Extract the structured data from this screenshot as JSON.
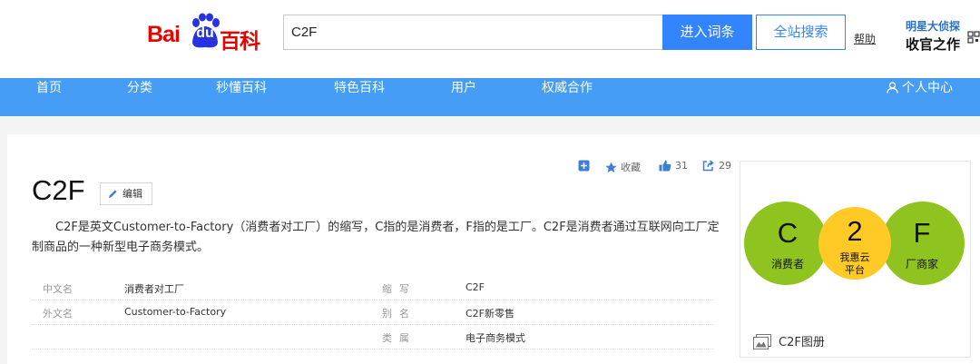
{
  "header": {
    "logo": {
      "bai": "Bai",
      "du": "du",
      "baike": "百科",
      "brand_color": "#e10602"
    },
    "search": {
      "value": "C2F"
    },
    "enter_button": "进入词条",
    "site_search_button": "全站搜索",
    "help": "帮助",
    "promo": {
      "line1": "明星大侦探",
      "line2": "收官之作"
    }
  },
  "nav": {
    "items": [
      "首页",
      "分类",
      "秒懂百科",
      "特色百科",
      "用户",
      "权威合作"
    ],
    "user_center": "个人中心",
    "bg_color": "#459df5"
  },
  "actions": {
    "collect": "收藏",
    "likes": "31",
    "shares": "29"
  },
  "article": {
    "title": "C2F",
    "edit": "编辑",
    "summary": "C2F是英文Customer-to-Factory（消费者对工厂）的缩写，C指的是消费者，F指的是工厂。C2F是消费者通过互联网向工厂定制商品的一种新型电子商务模式。",
    "basic_info": [
      {
        "k1": "中文名",
        "v1": "消费者对工厂",
        "k2": "缩写",
        "v2": "C2F"
      },
      {
        "k1": "外文名",
        "v1": "Customer-to-Factory",
        "k2": "别名",
        "v2": "C2F新零售"
      },
      {
        "k1": "",
        "v1": "",
        "k2": "类属",
        "v2": "电子商务模式"
      }
    ]
  },
  "album": {
    "label": "C2F图册",
    "diagram": {
      "left": {
        "big": "C",
        "small": "消费者"
      },
      "middle": {
        "big": "2",
        "small1": "我惠云",
        "small2": "平台"
      },
      "right": {
        "big": "F",
        "small": "厂商家"
      }
    }
  }
}
